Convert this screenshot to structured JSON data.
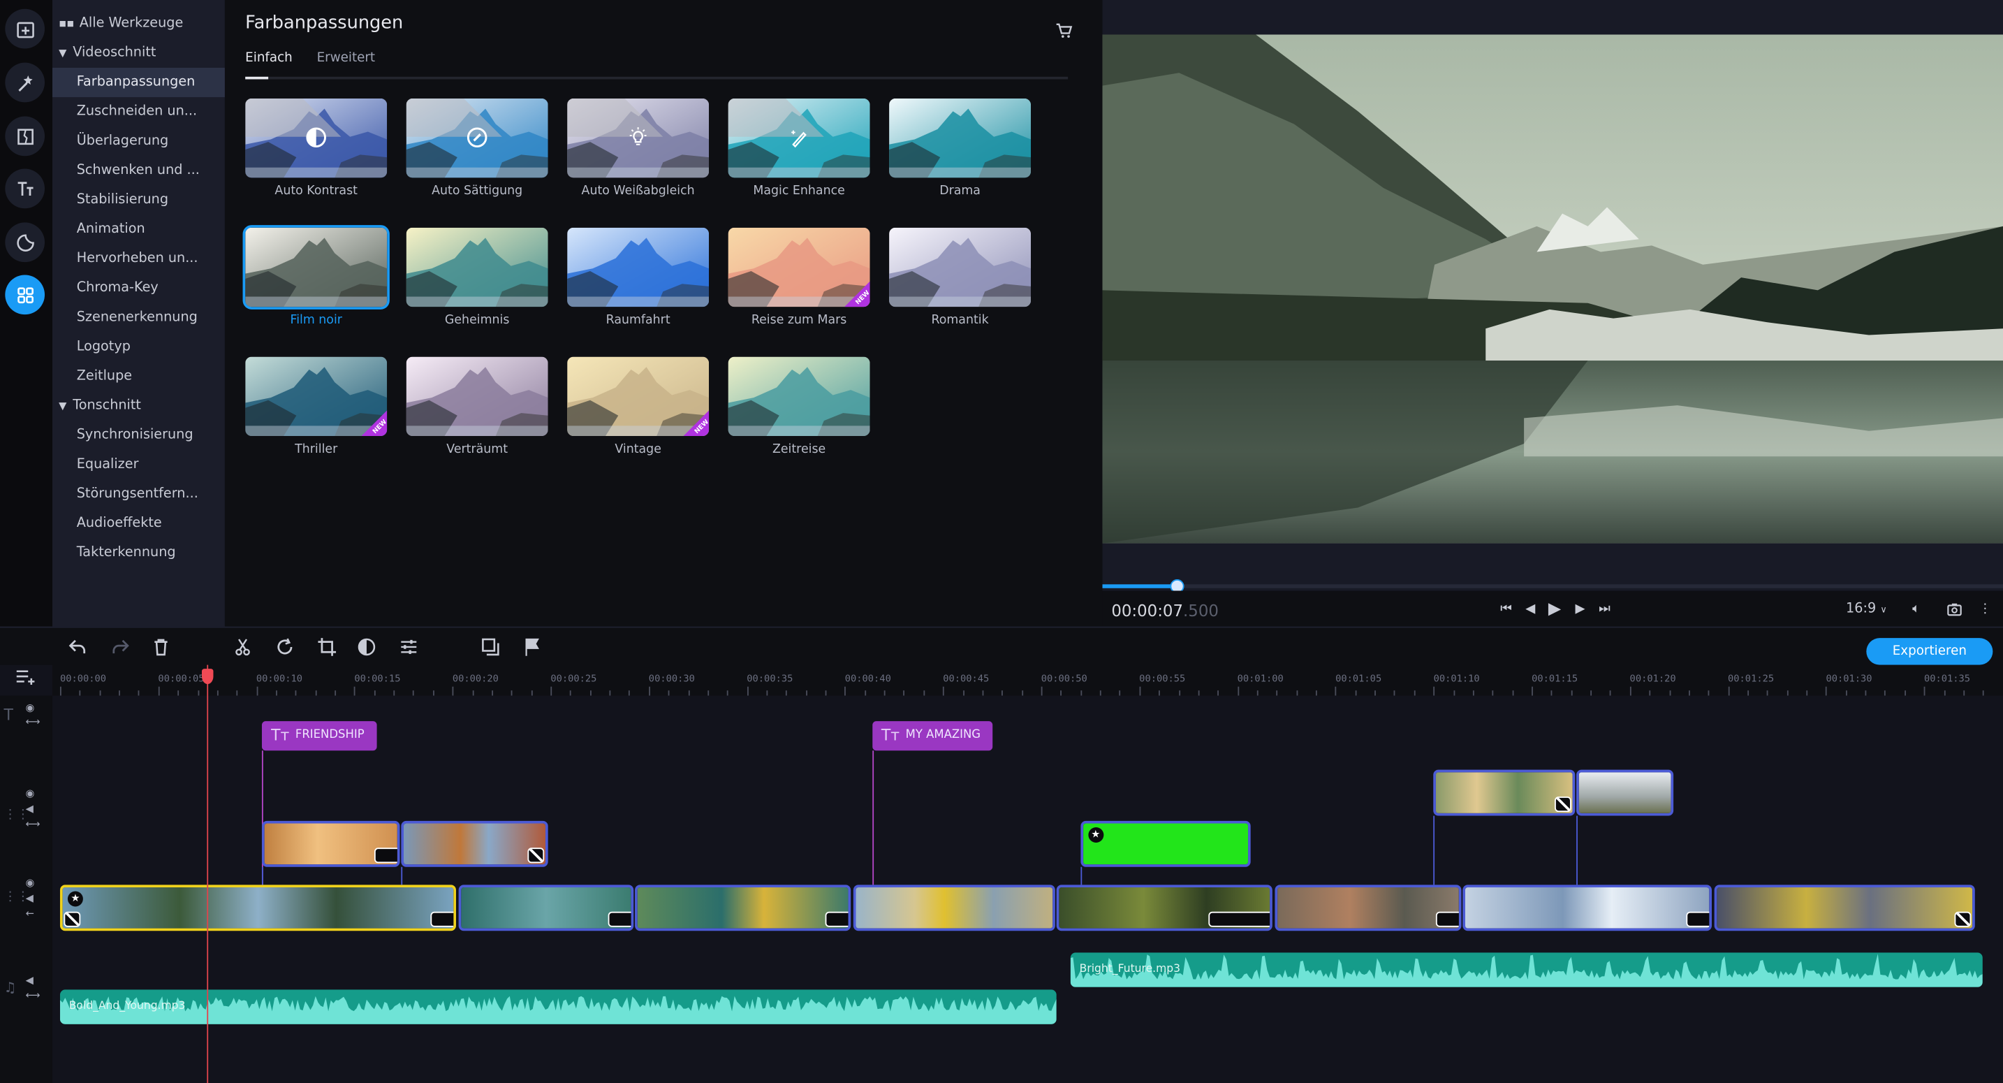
{
  "rail": {
    "items": [
      {
        "icon": "add-media-icon",
        "label": "Import"
      },
      {
        "icon": "magic-wand-icon",
        "label": "Effects"
      },
      {
        "icon": "transition-icon",
        "label": "Transitions"
      },
      {
        "icon": "titles-icon",
        "label": "Titles"
      },
      {
        "icon": "stickers-icon",
        "label": "Stickers"
      },
      {
        "icon": "all-tools-icon",
        "label": "Tools",
        "active": true
      }
    ]
  },
  "tools": {
    "all_tools": "Alle Werkzeuge",
    "sections": [
      {
        "label": "Videoschnitt",
        "items": [
          "Farbanpassungen",
          "Zuschneiden un...",
          "Überlagerung",
          "Schwenken und ...",
          "Stabilisierung",
          "Animation",
          "Hervorheben un...",
          "Chroma-Key",
          "Szenenerkennung",
          "Logotyp",
          "Zeitlupe"
        ]
      },
      {
        "label": "Tonschnitt",
        "items": [
          "Synchronisierung",
          "Equalizer",
          "Störungsentfern...",
          "Audioeffekte",
          "Takterkennung"
        ]
      }
    ],
    "active": "Farbanpassungen"
  },
  "effects": {
    "title": "Farbanpassungen",
    "tabs": [
      {
        "label": "Einfach",
        "active": true
      },
      {
        "label": "Erweitert",
        "active": false
      }
    ],
    "presets": [
      {
        "label": "Auto Kontrast",
        "icon": "contrast-icon",
        "auto": true
      },
      {
        "label": "Auto Sättigung",
        "icon": "saturation-icon",
        "auto": true
      },
      {
        "label": "Auto Weißabgleich",
        "icon": "lightbulb-icon",
        "auto": true
      },
      {
        "label": "Magic Enhance",
        "icon": "magic-pen-icon",
        "auto": true
      },
      {
        "label": "Drama"
      },
      {
        "label": "Film noir",
        "selected": true
      },
      {
        "label": "Geheimnis"
      },
      {
        "label": "Raumfahrt"
      },
      {
        "label": "Reise zum Mars",
        "new": true
      },
      {
        "label": "Romantik"
      },
      {
        "label": "Thriller",
        "new": true
      },
      {
        "label": "Verträumt"
      },
      {
        "label": "Vintage",
        "new": true
      },
      {
        "label": "Zeitreise"
      }
    ],
    "new_badge": "NEW"
  },
  "preview": {
    "timecode_main": "00:00:07",
    "timecode_ms": ".500",
    "progress_fraction": 0.082,
    "aspect_ratio": "16:9"
  },
  "timeline": {
    "export_label": "Exportieren",
    "ruler_labels": [
      "00:00:00",
      "00:00:05",
      "00:00:10",
      "00:00:15",
      "00:00:20",
      "00:00:25",
      "00:00:30",
      "00:00:35",
      "00:00:40",
      "00:00:45",
      "00:00:50",
      "00:00:55",
      "00:01:00",
      "00:01:05",
      "00:01:10",
      "00:01:15",
      "00:01:20",
      "00:01:25",
      "00:01:30",
      "00:01:35"
    ],
    "playhead_seconds": 7.5,
    "titles": [
      {
        "text": "FRIENDSHIP",
        "start": 10.3
      },
      {
        "text": "MY AMAZING",
        "start": 41.4
      }
    ],
    "audio": [
      {
        "name": "Bold_And_Young.mp3",
        "start": 0,
        "end": 50.8
      },
      {
        "name": "Bright_Future.mp3",
        "start": 51.5,
        "end": 98
      }
    ]
  },
  "colors": {
    "accent": "#1a9bf5",
    "title_clip": "#9a37c2",
    "audio_clip": "#159c8a",
    "playhead": "#e0454d",
    "selected_clip": "#f0d21c",
    "clip_border": "#4c5bd6",
    "new_badge": "#b033e0"
  }
}
